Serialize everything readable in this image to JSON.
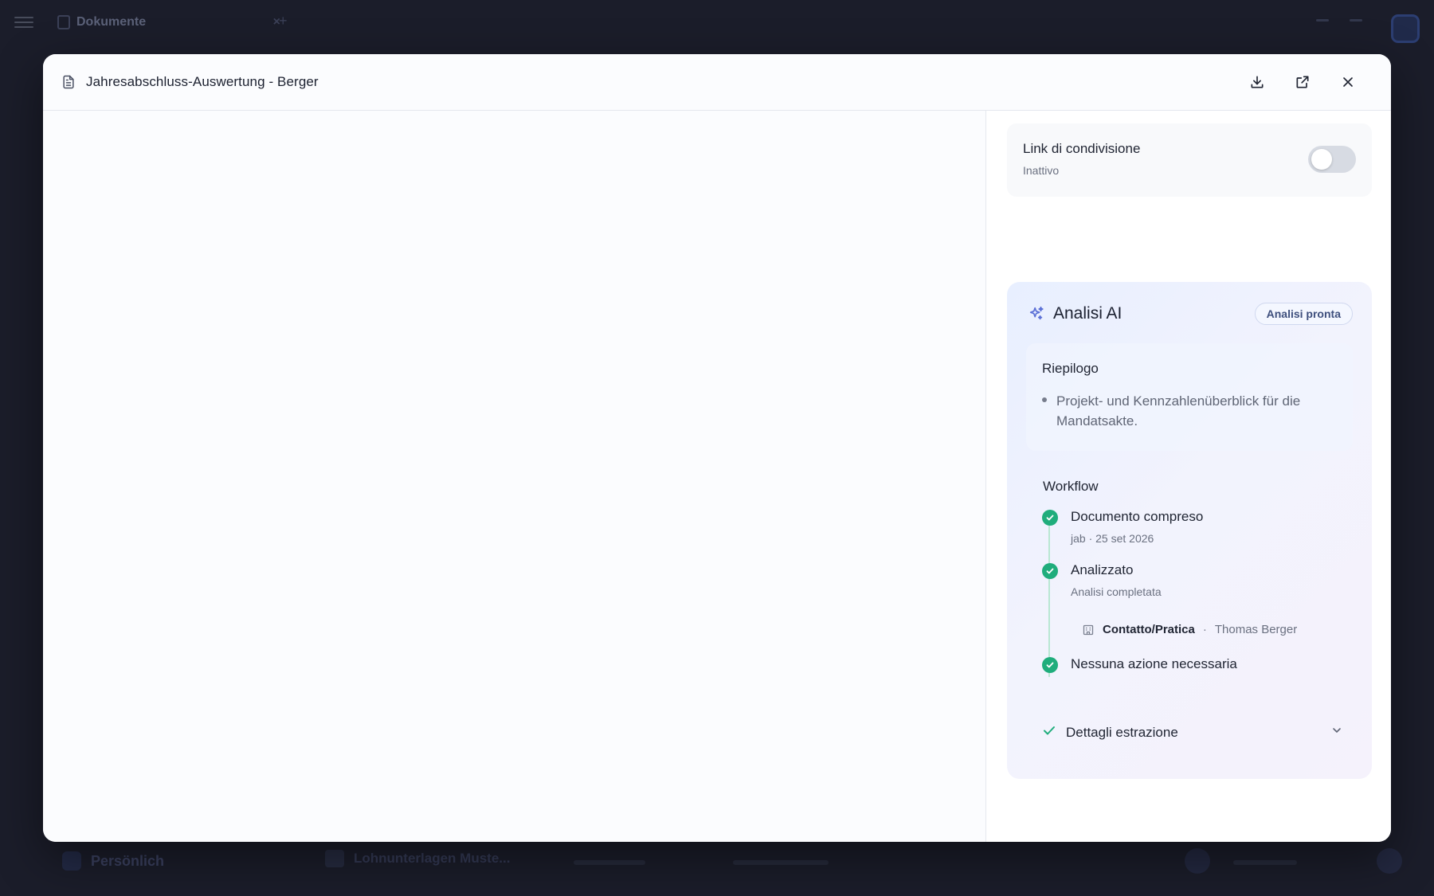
{
  "background": {
    "tab_label": "Dokumente",
    "workspace_label": "Persönlich",
    "document_label": "Lohnunterlagen Muste..."
  },
  "modal": {
    "title": "Jahresabschluss-Auswertung - Berger",
    "actions": {
      "download_icon": "download-icon",
      "open_external_icon": "external-link-icon",
      "close_icon": "close-icon"
    }
  },
  "share": {
    "title": "Link di condivisione",
    "status": "Inattivo",
    "enabled": false
  },
  "ai": {
    "title": "Analisi AI",
    "badge": "Analisi pronta",
    "summary": {
      "title": "Riepilogo",
      "items": [
        "Projekt- und Kennzahlenüberblick für die Mandatsakte."
      ]
    },
    "workflow": {
      "title": "Workflow",
      "steps": [
        {
          "title": "Documento compreso",
          "subtitle": "jab · 25 set 2026"
        },
        {
          "title": "Analizzato",
          "subtitle": "Analisi completata"
        },
        {
          "title": "Nessuna azione necessaria"
        }
      ],
      "contact": {
        "label": "Contatto/Pratica",
        "separator": "·",
        "value": "Thomas Berger"
      }
    },
    "details_label": "Dettagli estrazione"
  },
  "colors": {
    "accent_green": "#1fad7c",
    "ai_icon": "#5a6fd6",
    "backdrop": "#1b1d2a"
  }
}
